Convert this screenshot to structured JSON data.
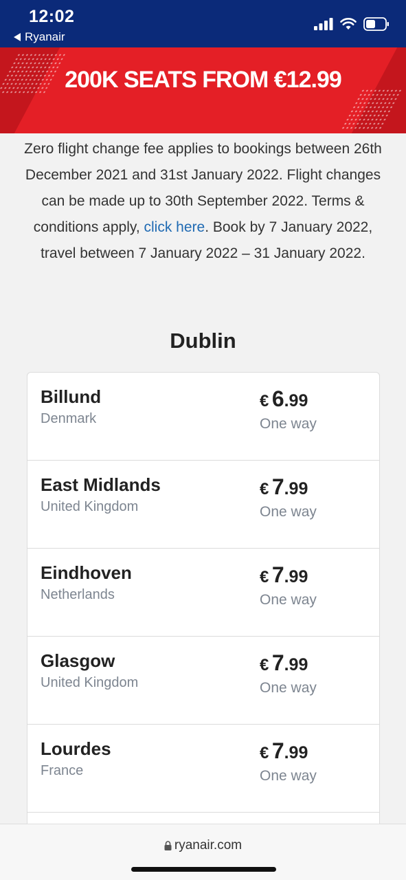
{
  "status_bar": {
    "time": "12:02",
    "back_label": "Ryanair",
    "icons": [
      "cellular-signal-icon",
      "wifi-icon",
      "battery-icon"
    ]
  },
  "banner": {
    "text": "200K SEATS FROM €12.99",
    "colors": {
      "background": "#e41f26",
      "stripe": "#c4161d"
    }
  },
  "intro": {
    "text_before_link": "Zero flight change fee applies to bookings between 26th December 2021 and 31st January 2022. Flight changes can be made up to 30th September 2022. Terms & conditions apply, ",
    "link_text": "click here",
    "text_after_link": ". Book by 7 January 2022, travel between 7 January 2022 – 31 January 2022."
  },
  "section": {
    "title": "Dublin"
  },
  "destinations": [
    {
      "city": "Billund",
      "country": "Denmark",
      "currency": "€",
      "price_int": "6",
      "price_dec": ".99",
      "fare_type": "One way"
    },
    {
      "city": "East Midlands",
      "country": "United Kingdom",
      "currency": "€",
      "price_int": "7",
      "price_dec": ".99",
      "fare_type": "One way"
    },
    {
      "city": "Eindhoven",
      "country": "Netherlands",
      "currency": "€",
      "price_int": "7",
      "price_dec": ".99",
      "fare_type": "One way"
    },
    {
      "city": "Glasgow",
      "country": "United Kingdom",
      "currency": "€",
      "price_int": "7",
      "price_dec": ".99",
      "fare_type": "One way"
    },
    {
      "city": "Lourdes",
      "country": "France",
      "currency": "€",
      "price_int": "7",
      "price_dec": ".99",
      "fare_type": "One way"
    }
  ],
  "browser": {
    "url": "ryanair.com",
    "url_icon": "lock-icon"
  },
  "colors": {
    "status_bar": "#0b2a79",
    "link": "#1f6ab3",
    "muted": "#7d8590"
  }
}
